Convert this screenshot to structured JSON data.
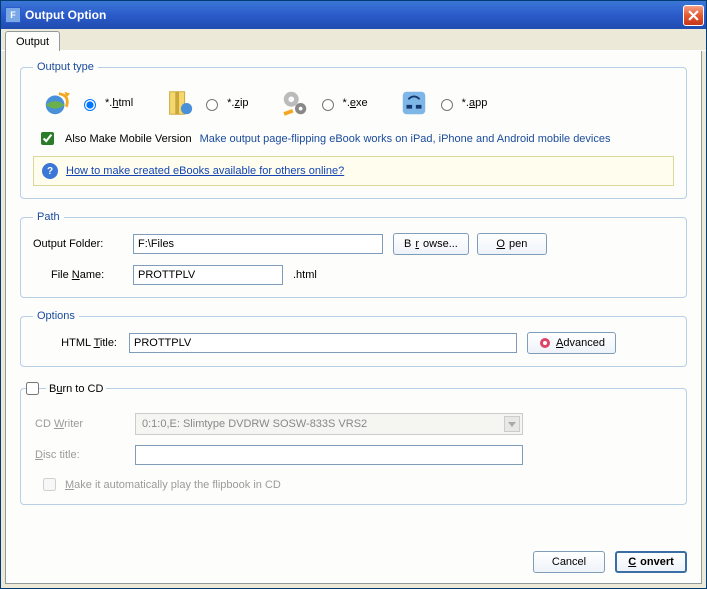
{
  "window": {
    "title": "Output Option"
  },
  "tabs": {
    "output": "Output"
  },
  "outputType": {
    "legend": "Output type",
    "html": "*.html",
    "zip": "*.zip",
    "exe": "*.exe",
    "app": "*.app",
    "mobileCheckbox": "Also Make Mobile Version",
    "mobileDesc": "Make output page-flipping eBook works on iPad, iPhone and Android mobile devices",
    "infoLink": "How to make created eBooks available for others online?"
  },
  "path": {
    "legend": "Path",
    "outputFolderLabel": "Output Folder:",
    "outputFolderValue": "F:\\Files",
    "browse": "Browse...",
    "open": "Open",
    "fileNameLabel": "File Name:",
    "fileNameValue": "PROTTPLV",
    "fileExt": ".html"
  },
  "options": {
    "legend": "Options",
    "htmlTitleLabel": "HTML Title:",
    "htmlTitleValue": "PROTTPLV",
    "advanced": "Advanced"
  },
  "burn": {
    "checkbox": "Burn to CD",
    "cdWriterLabel": "CD Writer",
    "cdWriterValue": "0:1:0,E: Slimtype DVDRW SOSW-833S  VRS2",
    "discTitleLabel": "Disc title:",
    "discTitleValue": "",
    "autoPlay": "Make it automatically play the flipbook in CD"
  },
  "footer": {
    "cancel": "Cancel",
    "convert": "Convert"
  }
}
